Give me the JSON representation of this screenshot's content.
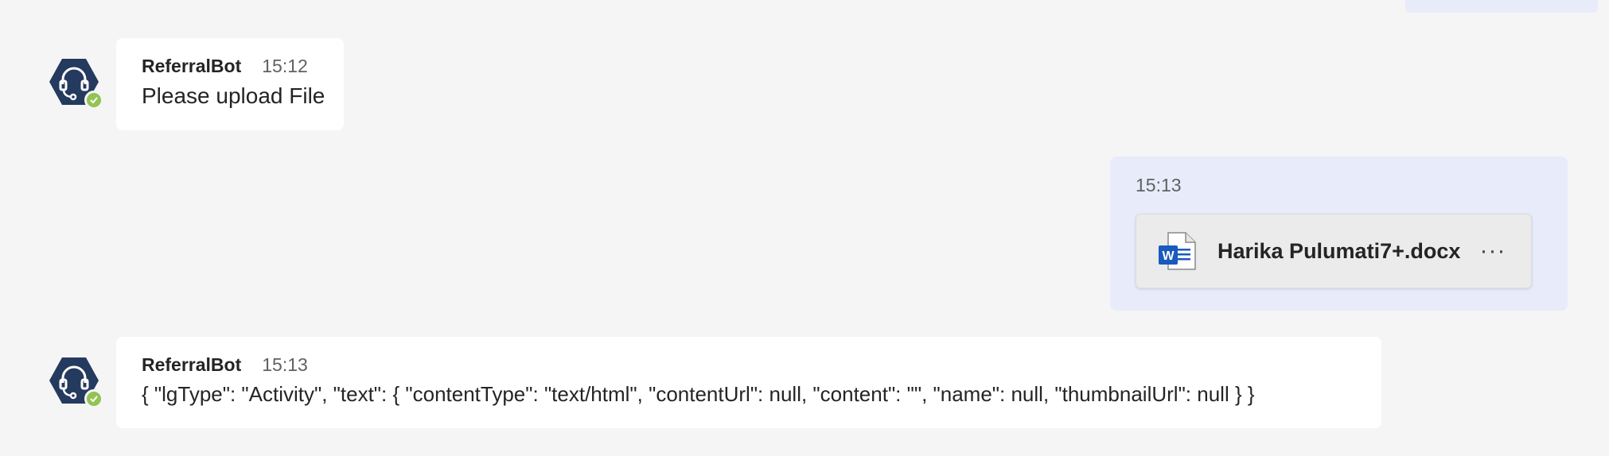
{
  "messages": [
    {
      "sender": "ReferralBot",
      "time": "15:12",
      "text": "Please upload File"
    },
    {
      "time": "15:13",
      "attachment": {
        "file_name": "Harika Pulumati7+.docx",
        "icon": "word-document-icon",
        "more_label": "···"
      }
    },
    {
      "sender": "ReferralBot",
      "time": "15:13",
      "text": "{ \"lgType\": \"Activity\", \"text\": { \"contentType\": \"text/html\", \"contentUrl\": null, \"content\": \"\", \"name\": null, \"thumbnailUrl\": null } }"
    }
  ],
  "colors": {
    "background": "#f5f5f5",
    "own_bubble": "#e8ebfa",
    "bot_bubble": "#ffffff",
    "presence_available": "#92c353",
    "avatar": "#243a5e",
    "word_blue": "#185abd"
  }
}
